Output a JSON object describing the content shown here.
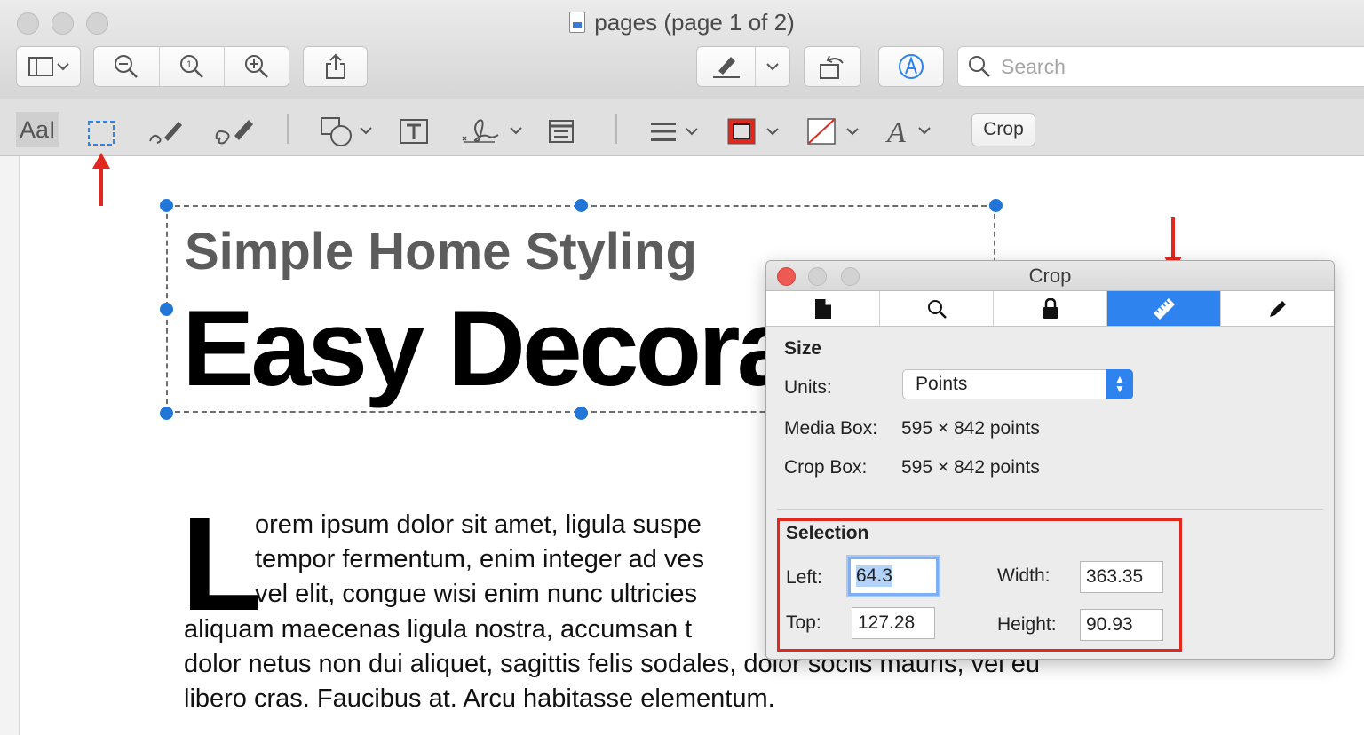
{
  "window": {
    "title": "pages (page 1 of 2)"
  },
  "toolbar": {
    "search_placeholder": "Search",
    "buttons": [
      "sidebar-view",
      "zoom-out",
      "actual-size",
      "zoom-in",
      "share",
      "highlight",
      "rotate",
      "markup"
    ]
  },
  "markup_toolbar": {
    "text_tool": "AaI",
    "crop_label": "Crop"
  },
  "document": {
    "subtitle": "Simple Home Styling",
    "title": "Easy Decora",
    "drop_cap": "L",
    "lines": [
      "orem ipsum dolor sit amet, ligula suspe",
      "tempor fermentum, enim integer ad ves",
      "vel elit, congue wisi enim nunc ultricies",
      "aliquam maecenas ligula nostra, accumsan t",
      "dolor netus non dui aliquet, sagittis felis sodales, dolor sociis mauris, vel eu",
      "libero cras. Faucibus at. Arcu habitasse elementum."
    ]
  },
  "inspector": {
    "title": "Crop",
    "tabs": [
      "document-info",
      "search",
      "encryption",
      "crop",
      "annotations"
    ],
    "active_tab": "crop",
    "size_heading": "Size",
    "units_label": "Units:",
    "units_value": "Points",
    "media_box_label": "Media Box:",
    "media_box_value": "595 × 842 points",
    "crop_box_label": "Crop Box:",
    "crop_box_value": "595 × 842 points",
    "selection_heading": "Selection",
    "left_label": "Left:",
    "left_value": "64.3",
    "top_label": "Top:",
    "top_value": "127.28",
    "width_label": "Width:",
    "width_value": "363.35",
    "height_label": "Height:",
    "height_value": "90.93"
  },
  "colors": {
    "accent": "#2f83ee",
    "annotation_red": "#e0281f",
    "handle_blue": "#2176d8"
  }
}
